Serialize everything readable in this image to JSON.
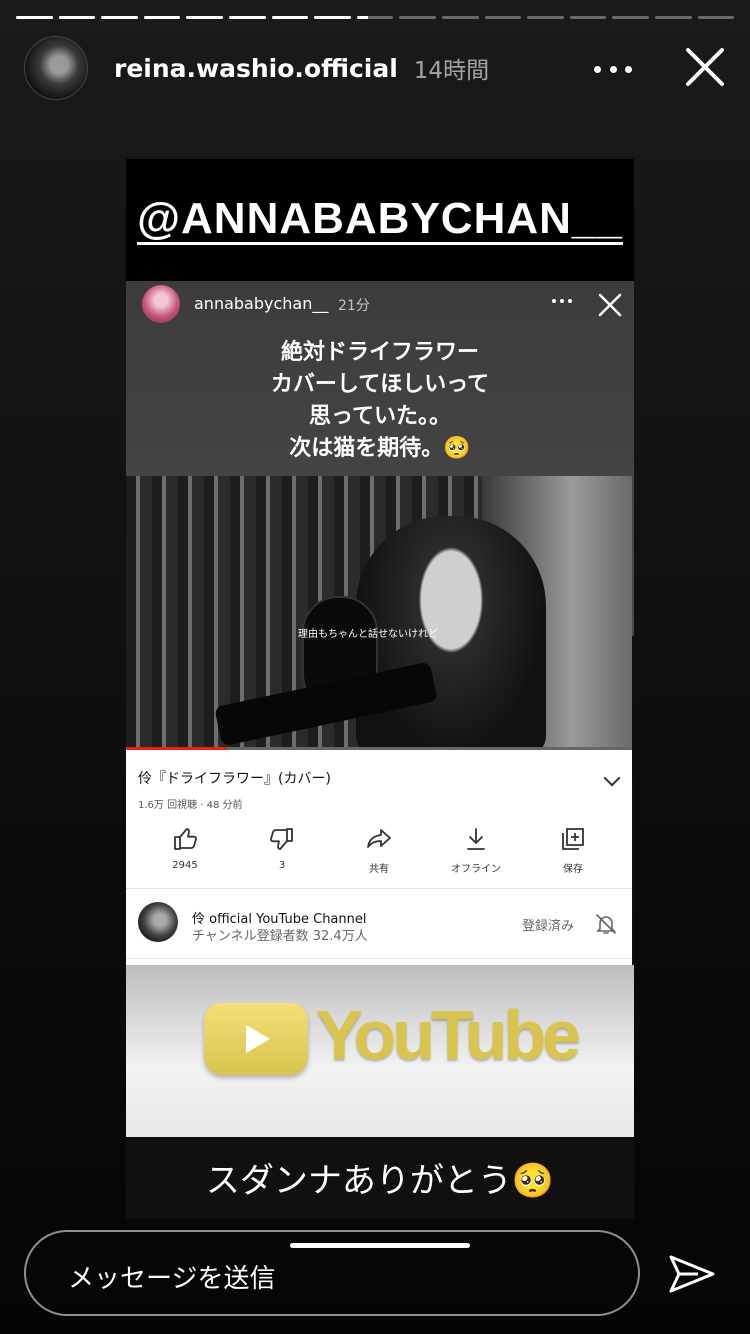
{
  "story": {
    "segments_total": 17,
    "segments_viewed": 8,
    "current_segment_progress": 0.3
  },
  "header": {
    "username": "reina.washio.official",
    "time": "14時間",
    "more_icon": "more-horizontal-icon",
    "close_icon": "close-icon"
  },
  "content": {
    "mention": "@ANNABABYCHAN__",
    "inner_story": {
      "username": "annababychan__",
      "time": "21分",
      "caption": [
        "絶対ドライフラワー",
        "カバーしてほしいって",
        "思っていた。。",
        "次は猫を期待。🥺"
      ]
    },
    "video": {
      "subtitle": "理由もちゃんと話せないけれど",
      "progress": 0.2
    },
    "youtube": {
      "title": "伶『ドライフラワー』(カバー)",
      "meta": "1.6万 回視聴 · 48 分前",
      "actions": [
        {
          "icon": "thumbs-up-icon",
          "label": "2945"
        },
        {
          "icon": "thumbs-down-icon",
          "label": "3"
        },
        {
          "icon": "share-icon",
          "label": "共有"
        },
        {
          "icon": "download-icon",
          "label": "オフライン"
        },
        {
          "icon": "save-playlist-icon",
          "label": "保存"
        }
      ],
      "channel_name": "伶 official YouTube Channel",
      "channel_subs": "チャンネル登録者数 32.4万人",
      "subscribed_label": "登録済み",
      "logo_text": "YouTube"
    },
    "bottom_caption": "スダンナありがとう🥺"
  },
  "footer": {
    "message_placeholder": "メッセージを送信",
    "send_icon": "send-icon"
  },
  "colors": {
    "background": "#111111",
    "accent_youtube_gold": "#d9c44e",
    "video_progress": "#e62117"
  }
}
